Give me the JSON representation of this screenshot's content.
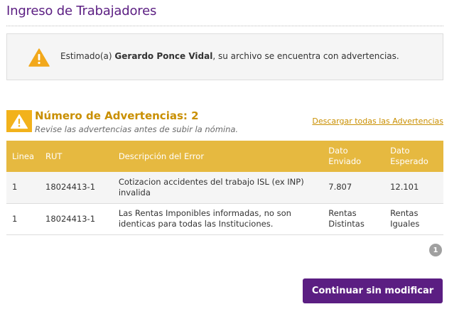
{
  "page": {
    "title": "Ingreso de Trabajadores"
  },
  "notice": {
    "icon": "warning-triangle-icon",
    "prefix": "Estimado(a) ",
    "user_name": "Gerardo Ponce Vidal",
    "suffix": ", su archivo se encuentra con advertencias."
  },
  "warnings": {
    "icon": "warning-triangle-icon",
    "count_label": "Número de Advertencias: 2",
    "subtitle": "Revise las advertencias antes de subir la nómina.",
    "download_link": "Descargar todas las Advertencias"
  },
  "table": {
    "headers": {
      "linea": "Linea",
      "rut": "RUT",
      "descripcion": "Descripción del Error",
      "enviado": "Dato Enviado",
      "esperado": "Dato Esperado"
    },
    "rows": [
      {
        "linea": "1",
        "rut": "18024413-1",
        "descripcion": "Cotizacion accidentes del trabajo ISL (ex INP) invalida",
        "enviado": "7.807",
        "esperado": "12.101"
      },
      {
        "linea": "1",
        "rut": "18024413-1",
        "descripcion": "Las Rentas Imponibles informadas, no son identicas para todas las Instituciones.",
        "enviado": "Rentas Distintas",
        "esperado": "Rentas Iguales"
      }
    ]
  },
  "pagination": {
    "current_page": "1"
  },
  "actions": {
    "continue_label": "Continuar sin modificar"
  },
  "colors": {
    "brand_purple": "#5b1e82",
    "accent_gold": "#f2b21b",
    "table_header": "#e6b940",
    "warning_text": "#c98f00"
  }
}
